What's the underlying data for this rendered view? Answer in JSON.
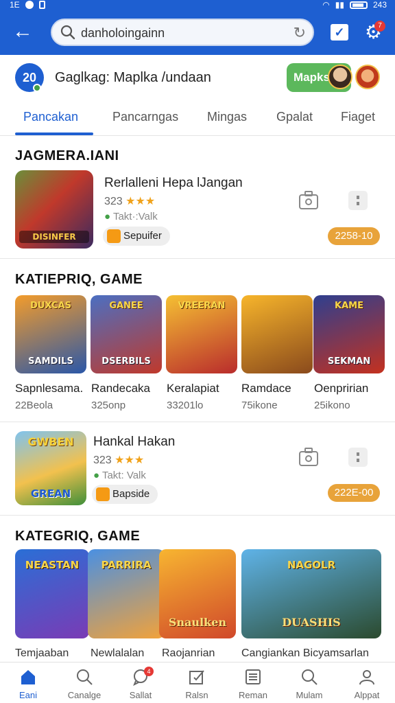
{
  "status_bar": {
    "left": "1E",
    "time": "243"
  },
  "search": {
    "value": "danholoingainn"
  },
  "notif_count": "7",
  "profile": {
    "level": "20",
    "name": "Gaglkag: Maplka /undaan",
    "badge": "Mapks"
  },
  "tabs": [
    {
      "label": "Pancakan"
    },
    {
      "label": "Pancarngas"
    },
    {
      "label": "Mingas"
    },
    {
      "label": "Gpalat"
    },
    {
      "label": "Fiaget"
    }
  ],
  "section1": {
    "title": "JAGMERA.IANI",
    "item": {
      "art_text": "DISINFER",
      "title": "Rerlalleni Hepa lJangan",
      "rating": "323",
      "stars": "★★★",
      "online": "Takt·:Valk",
      "tag": "Sepuifer",
      "price": "2258-10"
    }
  },
  "section2": {
    "title": "KATIEPRIQ, GAME",
    "cards": [
      {
        "art_top": "DUXCAS",
        "art_bottom": "SAMDILS",
        "name": "Sapnlesama.",
        "count": "22Beola",
        "c1": "#f39c2b",
        "c2": "#2a57a8"
      },
      {
        "art_top": "GANEE",
        "art_bottom": "DSERBILS",
        "name": "Randecaka",
        "count": "325onp",
        "c1": "#4b6fc2",
        "c2": "#c0392b"
      },
      {
        "art_top": "VREERAN",
        "art_bottom": "",
        "name": "Keralapiat",
        "count": "33201lo",
        "c1": "#f5c033",
        "c2": "#b92c2c"
      },
      {
        "art_top": "",
        "art_bottom": "",
        "name": "Ramdace",
        "count": "75ikone",
        "c1": "#f7b52b",
        "c2": "#8a4a1c"
      },
      {
        "art_top": "KAME",
        "art_bottom": "SEKMAN",
        "name": "Oenpririan",
        "count": "25ikono",
        "c1": "#2e3f8f",
        "c2": "#c4311f"
      }
    ]
  },
  "section3": {
    "item": {
      "art_top": "GWBEN",
      "art_bottom": "GREAN",
      "title": "Hankal Hakan",
      "rating": "323",
      "stars": "★★★",
      "online": "Takt: Valk",
      "tag": "Bapside",
      "price": "222E-00"
    }
  },
  "section4": {
    "title": "KATEGRIQ, GAME",
    "banners": [
      {
        "art_top": "NEASTAN",
        "art_bottom": "",
        "c1": "#2a6fd6",
        "c2": "#7a3bb5"
      },
      {
        "art_top": "PARRIRA",
        "art_bottom": "",
        "c1": "#4a90e2",
        "c2": "#f2a23a"
      },
      {
        "art_top": "",
        "art_bottom": "Snaulken",
        "c1": "#f7b531",
        "c2": "#d0482a"
      },
      {
        "art_top": "NAGOLR",
        "art_bottom": "DUASHIS",
        "c1": "#5fb3e8",
        "c2": "#2b4a2e"
      }
    ],
    "labels": [
      {
        "text": "Temjaaban"
      },
      {
        "text": "Newlalalan"
      },
      {
        "text": "Raojanrian"
      },
      {
        "text": "Cangiankan Bicyamsarlan"
      }
    ]
  },
  "bottom_nav": [
    {
      "label": "Eani",
      "icon": "home-icon"
    },
    {
      "label": "Canalge",
      "icon": "search-icon"
    },
    {
      "label": "Sallat",
      "icon": "chat-icon",
      "badge": "4"
    },
    {
      "label": "Ralsn",
      "icon": "edit-icon"
    },
    {
      "label": "Reman",
      "icon": "list-icon"
    },
    {
      "label": "Mulam",
      "icon": "search-icon"
    },
    {
      "label": "Alppat",
      "icon": "profile-icon"
    }
  ]
}
